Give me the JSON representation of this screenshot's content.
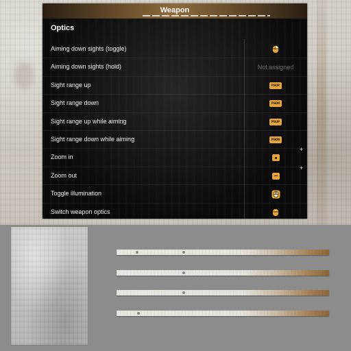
{
  "header": {
    "title": "Weapon"
  },
  "section": {
    "title": "Optics"
  },
  "rows": [
    {
      "label": "Aiming down sights (toggle)",
      "binding_type": "icon",
      "icon": "mouse-right-click-icon"
    },
    {
      "label": "Aiming down sights (hold)",
      "binding_type": "text",
      "value": "Not assigned"
    },
    {
      "label": "Sight range up",
      "binding_type": "key",
      "value": "PGUP"
    },
    {
      "label": "Sight range down",
      "binding_type": "key",
      "value": "PGDN"
    },
    {
      "label": "Sight range up while aiming",
      "binding_type": "key",
      "value": "PGUP"
    },
    {
      "label": "Sight range down while aiming",
      "binding_type": "key",
      "value": "PGDN"
    },
    {
      "label": "Zoom in",
      "binding_type": "icon",
      "icon": "numpad-plus-icon",
      "extra": "+"
    },
    {
      "label": "Zoom out",
      "binding_type": "icon",
      "icon": "numpad-minus-icon",
      "extra": "+"
    },
    {
      "label": "Toggle illumination",
      "binding_type": "icon",
      "icon": "mouse-wheel-click-icon"
    },
    {
      "label": "Switch weapon optics",
      "binding_type": "icon",
      "icon": "mouse-middle-click-icon"
    }
  ],
  "colors": {
    "key_badge": "#e4a43a",
    "panel_bg": "#111111",
    "header_accent": "#8d6b3c",
    "unassigned_text": "#6a6a6a"
  }
}
